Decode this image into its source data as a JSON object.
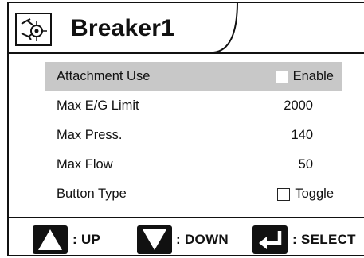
{
  "header": {
    "title": "Breaker1",
    "icon": "breaker-attachment-icon"
  },
  "settings": [
    {
      "label": "Attachment Use",
      "type": "checkbox",
      "checked": false,
      "value": "Enable",
      "selected": true
    },
    {
      "label": "Max E/G Limit",
      "type": "value",
      "value": "2000"
    },
    {
      "label": "Max Press.",
      "type": "value",
      "value": "140"
    },
    {
      "label": "Max Flow",
      "type": "value",
      "value": "50"
    },
    {
      "label": "Button Type",
      "type": "checkbox",
      "checked": false,
      "value": "Toggle"
    }
  ],
  "footer": {
    "up_label": ": UP",
    "down_label": ": DOWN",
    "select_label": ": SELECT"
  },
  "colors": {
    "selected_row": "#c8c8c8",
    "ink": "#111111",
    "background": "#ffffff"
  }
}
